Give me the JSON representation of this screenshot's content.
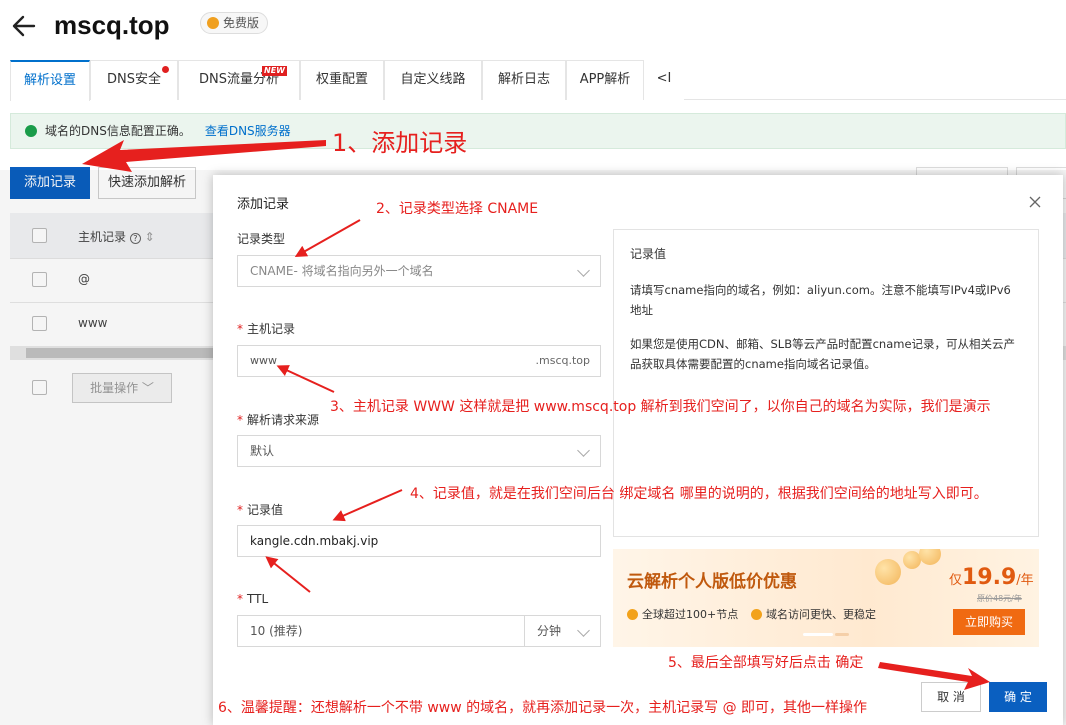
{
  "header": {
    "domain": "mscq.top",
    "edition": "免费版"
  },
  "tabs": [
    {
      "label": "解析设置"
    },
    {
      "label": "DNS安全"
    },
    {
      "label": "DNS流量分析"
    },
    {
      "label": "权重配置"
    },
    {
      "label": "自定义线路"
    },
    {
      "label": "解析日志"
    },
    {
      "label": "APP解析"
    },
    {
      "label": "<I"
    }
  ],
  "tab_new_badge": "NEW",
  "notice": {
    "text": "域名的DNS信息配置正确。",
    "link": "查看DNS服务器"
  },
  "toolbar": {
    "add_record": "添加记录",
    "quick_add": "快速添加解析"
  },
  "table": {
    "host_header": "主机记录",
    "rows": [
      "@",
      "www"
    ],
    "batch": "批量操作"
  },
  "modal": {
    "title": "添加记录",
    "record_type_label": "记录类型",
    "record_type_value": "CNAME- 将域名指向另外一个域名",
    "host_label": "主机记录",
    "host_value": "www",
    "host_suffix": ".mscq.top",
    "source_label": "解析请求来源",
    "source_value": "默认",
    "value_label": "记录值",
    "value_value": "kangle.cdn.mbakj.vip",
    "ttl_label": "TTL",
    "ttl_value": "10 (推荐)",
    "ttl_unit": "分钟",
    "cancel": "取 消",
    "confirm": "确 定",
    "info": {
      "title": "记录值",
      "p1": "请填写cname指向的域名，例如：aliyun.com。注意不能填写IPv4或IPv6地址",
      "p2": "如果您是使用CDN、邮箱、SLB等云产品时配置cname记录，可从相关云产品获取具体需要配置的cname指向域名记录值。"
    },
    "promo": {
      "title": "云解析个人版低价优惠",
      "price_prefix": "仅",
      "price": "19.9",
      "price_unit": "/年",
      "original": "原价48元/年",
      "feature1": "全球超过100+节点",
      "feature2": "域名访问更快、更稳定",
      "buy": "立即购买"
    }
  },
  "annotations": {
    "a1": "1、添加记录",
    "a2": "2、记录类型选择 CNAME",
    "a3": "3、主机记录 WWW  这样就是把 www.mscq.top 解析到我们空间了，以你自己的域名为实际，我们是演示",
    "a4": "4、记录值，就是在我们空间后台 绑定域名 哪里的说明的，根据我们空间给的地址写入即可。",
    "a5": "5、最后全部填写好后点击 确定",
    "a6": "6、温馨提醒：还想解析一个不带 www 的域名，就再添加记录一次，主机记录写 @ 即可，其他一样操作"
  },
  "colors": {
    "primary": "#0a5fc0",
    "annotation": "#e6201e",
    "promo_orange": "#f06a12"
  }
}
